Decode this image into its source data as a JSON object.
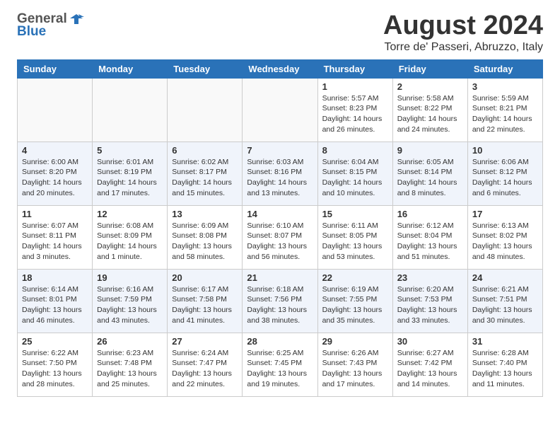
{
  "header": {
    "logo_general": "General",
    "logo_blue": "Blue",
    "month": "August 2024",
    "location": "Torre de' Passeri, Abruzzo, Italy"
  },
  "days_of_week": [
    "Sunday",
    "Monday",
    "Tuesday",
    "Wednesday",
    "Thursday",
    "Friday",
    "Saturday"
  ],
  "weeks": [
    [
      {
        "day": "",
        "info": ""
      },
      {
        "day": "",
        "info": ""
      },
      {
        "day": "",
        "info": ""
      },
      {
        "day": "",
        "info": ""
      },
      {
        "day": "1",
        "info": "Sunrise: 5:57 AM\nSunset: 8:23 PM\nDaylight: 14 hours\nand 26 minutes."
      },
      {
        "day": "2",
        "info": "Sunrise: 5:58 AM\nSunset: 8:22 PM\nDaylight: 14 hours\nand 24 minutes."
      },
      {
        "day": "3",
        "info": "Sunrise: 5:59 AM\nSunset: 8:21 PM\nDaylight: 14 hours\nand 22 minutes."
      }
    ],
    [
      {
        "day": "4",
        "info": "Sunrise: 6:00 AM\nSunset: 8:20 PM\nDaylight: 14 hours\nand 20 minutes."
      },
      {
        "day": "5",
        "info": "Sunrise: 6:01 AM\nSunset: 8:19 PM\nDaylight: 14 hours\nand 17 minutes."
      },
      {
        "day": "6",
        "info": "Sunrise: 6:02 AM\nSunset: 8:17 PM\nDaylight: 14 hours\nand 15 minutes."
      },
      {
        "day": "7",
        "info": "Sunrise: 6:03 AM\nSunset: 8:16 PM\nDaylight: 14 hours\nand 13 minutes."
      },
      {
        "day": "8",
        "info": "Sunrise: 6:04 AM\nSunset: 8:15 PM\nDaylight: 14 hours\nand 10 minutes."
      },
      {
        "day": "9",
        "info": "Sunrise: 6:05 AM\nSunset: 8:14 PM\nDaylight: 14 hours\nand 8 minutes."
      },
      {
        "day": "10",
        "info": "Sunrise: 6:06 AM\nSunset: 8:12 PM\nDaylight: 14 hours\nand 6 minutes."
      }
    ],
    [
      {
        "day": "11",
        "info": "Sunrise: 6:07 AM\nSunset: 8:11 PM\nDaylight: 14 hours\nand 3 minutes."
      },
      {
        "day": "12",
        "info": "Sunrise: 6:08 AM\nSunset: 8:09 PM\nDaylight: 14 hours\nand 1 minute."
      },
      {
        "day": "13",
        "info": "Sunrise: 6:09 AM\nSunset: 8:08 PM\nDaylight: 13 hours\nand 58 minutes."
      },
      {
        "day": "14",
        "info": "Sunrise: 6:10 AM\nSunset: 8:07 PM\nDaylight: 13 hours\nand 56 minutes."
      },
      {
        "day": "15",
        "info": "Sunrise: 6:11 AM\nSunset: 8:05 PM\nDaylight: 13 hours\nand 53 minutes."
      },
      {
        "day": "16",
        "info": "Sunrise: 6:12 AM\nSunset: 8:04 PM\nDaylight: 13 hours\nand 51 minutes."
      },
      {
        "day": "17",
        "info": "Sunrise: 6:13 AM\nSunset: 8:02 PM\nDaylight: 13 hours\nand 48 minutes."
      }
    ],
    [
      {
        "day": "18",
        "info": "Sunrise: 6:14 AM\nSunset: 8:01 PM\nDaylight: 13 hours\nand 46 minutes."
      },
      {
        "day": "19",
        "info": "Sunrise: 6:16 AM\nSunset: 7:59 PM\nDaylight: 13 hours\nand 43 minutes."
      },
      {
        "day": "20",
        "info": "Sunrise: 6:17 AM\nSunset: 7:58 PM\nDaylight: 13 hours\nand 41 minutes."
      },
      {
        "day": "21",
        "info": "Sunrise: 6:18 AM\nSunset: 7:56 PM\nDaylight: 13 hours\nand 38 minutes."
      },
      {
        "day": "22",
        "info": "Sunrise: 6:19 AM\nSunset: 7:55 PM\nDaylight: 13 hours\nand 35 minutes."
      },
      {
        "day": "23",
        "info": "Sunrise: 6:20 AM\nSunset: 7:53 PM\nDaylight: 13 hours\nand 33 minutes."
      },
      {
        "day": "24",
        "info": "Sunrise: 6:21 AM\nSunset: 7:51 PM\nDaylight: 13 hours\nand 30 minutes."
      }
    ],
    [
      {
        "day": "25",
        "info": "Sunrise: 6:22 AM\nSunset: 7:50 PM\nDaylight: 13 hours\nand 28 minutes."
      },
      {
        "day": "26",
        "info": "Sunrise: 6:23 AM\nSunset: 7:48 PM\nDaylight: 13 hours\nand 25 minutes."
      },
      {
        "day": "27",
        "info": "Sunrise: 6:24 AM\nSunset: 7:47 PM\nDaylight: 13 hours\nand 22 minutes."
      },
      {
        "day": "28",
        "info": "Sunrise: 6:25 AM\nSunset: 7:45 PM\nDaylight: 13 hours\nand 19 minutes."
      },
      {
        "day": "29",
        "info": "Sunrise: 6:26 AM\nSunset: 7:43 PM\nDaylight: 13 hours\nand 17 minutes."
      },
      {
        "day": "30",
        "info": "Sunrise: 6:27 AM\nSunset: 7:42 PM\nDaylight: 13 hours\nand 14 minutes."
      },
      {
        "day": "31",
        "info": "Sunrise: 6:28 AM\nSunset: 7:40 PM\nDaylight: 13 hours\nand 11 minutes."
      }
    ]
  ]
}
